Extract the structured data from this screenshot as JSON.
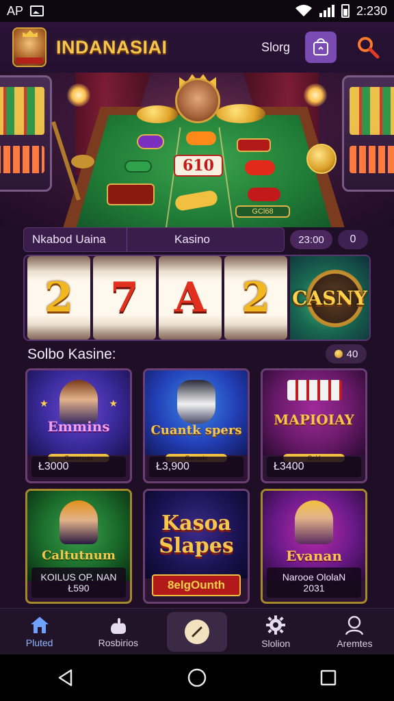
{
  "status_bar": {
    "left_text": "AP",
    "time": "2:230"
  },
  "header": {
    "app_name": "INDANASIAI",
    "store_label": "Slorg",
    "icons": [
      "app-logo-icon",
      "store-bag-icon",
      "search-icon"
    ]
  },
  "promo_bar": {
    "label": "Nkabod Uaina",
    "tab": "Kasino",
    "score": "23:00",
    "count": "0"
  },
  "hero": {
    "table_center": "610",
    "table_corner": "GCl68"
  },
  "reels": {
    "symbols": [
      "2",
      "7",
      "A",
      "2"
    ],
    "badge": "CASNY"
  },
  "section": {
    "title": "Solbo Kasine:",
    "coin_value": "40"
  },
  "games": [
    {
      "title": "Emmins",
      "subtitle": "Gammuas",
      "footer": "Ł3000",
      "theme": "purple-blue"
    },
    {
      "title": "Cuantk spers",
      "subtitle": "Gamwin",
      "footer": "Ł3,900",
      "theme": "blue"
    },
    {
      "title": "MAPIOIAY",
      "subtitle": "Gold",
      "footer": "Ł3400",
      "theme": "magenta"
    },
    {
      "title": "Caltutnum",
      "subtitle": "",
      "footer_line1": "KOILUS OP. NAN",
      "footer_line2": "Ł590",
      "theme": "green"
    },
    {
      "title": "Kasoa Slapes",
      "subtitle": "",
      "footer": "8elgOunth",
      "theme": "navy-gold"
    },
    {
      "title": "Evanan",
      "subtitle": "",
      "footer_line1": "Narooe OlolaN",
      "footer_line2": "2031",
      "theme": "violet"
    }
  ],
  "bottom_nav": {
    "items": [
      {
        "label": "Pluted",
        "icon": "home-icon",
        "active": true
      },
      {
        "label": "Rosbirios",
        "icon": "hand-icon",
        "active": false
      },
      {
        "label": "",
        "icon": "compass-icon",
        "active": false
      },
      {
        "label": "Slolion",
        "icon": "gear-icon",
        "active": false
      },
      {
        "label": "Aremtes",
        "icon": "user-icon",
        "active": false
      }
    ]
  },
  "system_nav": {
    "icons": [
      "back-icon",
      "home-circle-icon",
      "recents-icon"
    ]
  },
  "colors": {
    "background": "#1e0f26",
    "accent_gold": "#f7c64d",
    "accent_purple": "#7a4bb2",
    "nav_active": "#8fb6ff"
  }
}
